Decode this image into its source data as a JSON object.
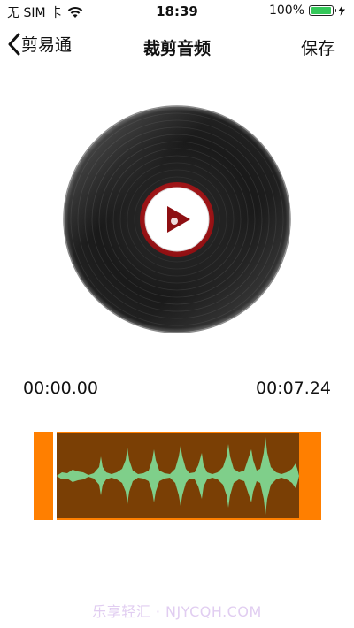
{
  "status_bar": {
    "carrier": "无 SIM 卡",
    "time": "18:39",
    "battery_text": "100%",
    "battery_level": 1.0,
    "battery_color": "#34c759"
  },
  "nav": {
    "back_label": "剪易通",
    "title": "裁剪音频",
    "save_label": "保存"
  },
  "player": {
    "start_time": "00:00.00",
    "end_time": "00:07.24",
    "record_icon": "vinyl-record-icon",
    "play_icon": "play-icon",
    "label_color": "#b0171b"
  },
  "trimmer": {
    "handle_color": "#ff7f00",
    "selection_color": "#7a3f05",
    "wave_color": "#7fcf8a"
  },
  "watermark": "乐享轻汇 · NJYCQH.COM"
}
